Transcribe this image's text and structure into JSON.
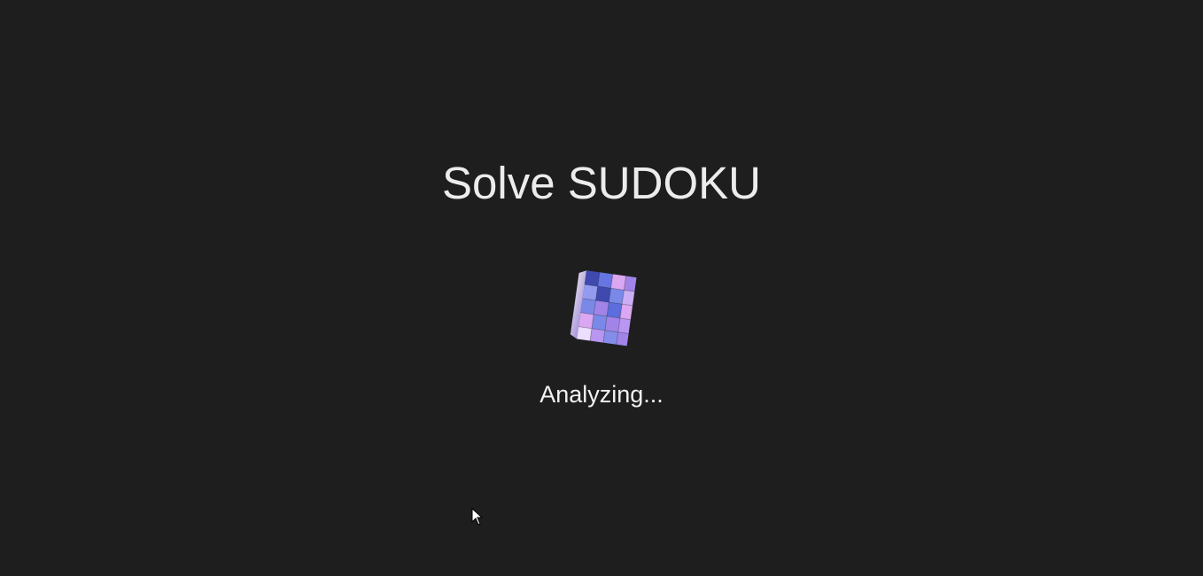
{
  "page": {
    "title": "Solve SUDOKU",
    "status_text": "Analyzing..."
  },
  "loader": {
    "icon": "rubiks-cube-icon",
    "state": "animating"
  },
  "colors": {
    "background": "#1e1e1e",
    "title_text": "#ececec",
    "status_text": "#f2f2f2",
    "cube_deep_blue": "#2f3aa8",
    "cube_blue": "#6f7fe6",
    "cube_violet": "#9b7ae8",
    "cube_pink": "#d9a0f0",
    "cube_light": "#eadcff"
  }
}
